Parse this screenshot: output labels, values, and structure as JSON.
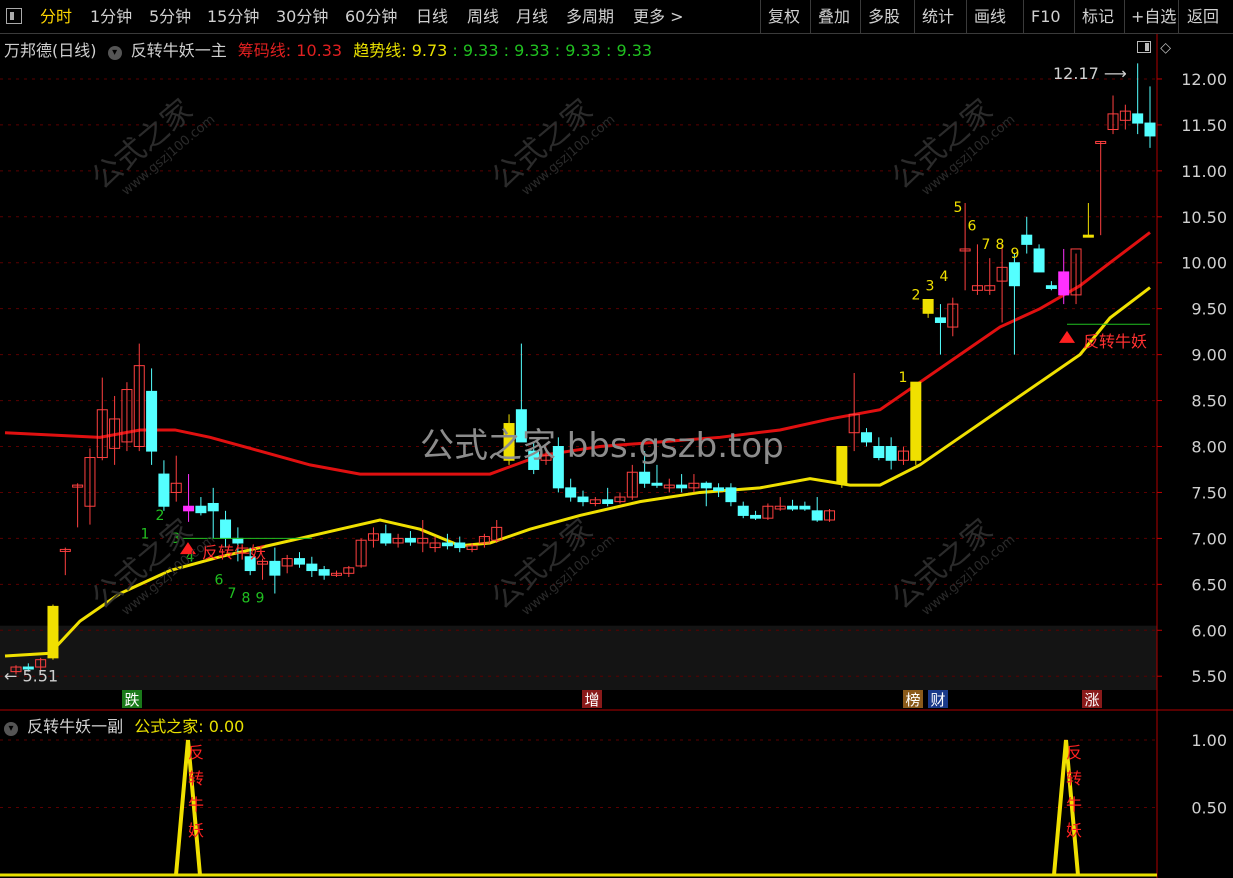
{
  "toolbar": {
    "left_items": [
      "分时",
      "1分钟",
      "5分钟",
      "15分钟",
      "30分钟",
      "60分钟",
      "日线",
      "周线",
      "月线",
      "多周期",
      "更多 >"
    ],
    "right_items": [
      "复权",
      "叠加",
      "多股",
      "统计",
      "画线",
      "F10",
      "标记",
      "+自选",
      "返回"
    ],
    "active": "分时"
  },
  "main_panel": {
    "stock_label": "万邦德(日线)",
    "indicator_name": "反转牛妖一主",
    "chip_label": "筹码线:",
    "chip_value": "10.33",
    "trend_label": "趋势线:",
    "trend_value": "9.73",
    "trend_extra": ": 9.33 : 9.33 : 9.33 : 9.33",
    "high_marker": "12.17",
    "low_marker": "5.51",
    "signal_text": "反转牛妖",
    "bottom_tags": [
      {
        "text": "跌",
        "color": "#1a7a1a"
      },
      {
        "text": "增",
        "color": "#8a1a1a"
      },
      {
        "text": "榜",
        "color": "#8a5a1a"
      },
      {
        "text": "财",
        "color": "#1a3a8a"
      },
      {
        "text": "涨",
        "color": "#8a1a1a"
      }
    ]
  },
  "sub_panel": {
    "indicator_name": "反转牛妖一副",
    "value_label": "公式之家:",
    "value": "0.00",
    "signal_text": "反转牛妖",
    "y_ticks": [
      "1.00",
      "0.50"
    ]
  },
  "watermark": {
    "center": "公式之家 bbs.gszb.top",
    "tile_text": "公式之家",
    "tile_url": "www.gszj100.com"
  },
  "chart_data": {
    "type": "candlestick",
    "ylim": [
      5.35,
      12.25
    ],
    "y_ticks": [
      12.0,
      11.5,
      11.0,
      10.5,
      10.0,
      9.5,
      9.0,
      8.5,
      8.0,
      7.5,
      7.0,
      6.5,
      6.0,
      5.5
    ],
    "candles": [
      [
        5.55,
        5.62,
        5.52,
        5.6
      ],
      [
        5.6,
        5.64,
        5.55,
        5.58
      ],
      [
        5.6,
        5.7,
        5.56,
        5.68
      ],
      [
        5.7,
        6.28,
        5.68,
        6.26
      ],
      [
        6.88,
        6.9,
        6.6,
        6.88
      ],
      [
        7.58,
        7.6,
        7.12,
        7.58
      ],
      [
        7.35,
        7.98,
        7.15,
        7.88
      ],
      [
        7.88,
        8.75,
        7.85,
        8.4
      ],
      [
        7.98,
        8.55,
        7.8,
        8.3
      ],
      [
        8.05,
        8.7,
        7.95,
        8.62
      ],
      [
        8.0,
        9.12,
        7.95,
        8.88
      ],
      [
        8.6,
        8.85,
        7.8,
        7.95
      ],
      [
        7.7,
        7.85,
        7.3,
        7.35
      ],
      [
        7.5,
        7.9,
        7.4,
        7.6
      ],
      [
        7.3,
        7.7,
        7.18,
        7.35
      ],
      [
        7.35,
        7.45,
        7.25,
        7.28
      ],
      [
        7.38,
        7.55,
        7.0,
        7.3
      ],
      [
        7.2,
        7.3,
        6.9,
        7.0
      ],
      [
        7.0,
        7.12,
        6.75,
        6.95
      ],
      [
        6.8,
        6.9,
        6.6,
        6.65
      ],
      [
        6.72,
        6.78,
        6.55,
        6.75
      ],
      [
        6.75,
        6.9,
        6.4,
        6.6
      ],
      [
        6.7,
        6.82,
        6.62,
        6.78
      ],
      [
        6.78,
        6.85,
        6.68,
        6.72
      ],
      [
        6.72,
        6.8,
        6.58,
        6.65
      ],
      [
        6.66,
        6.7,
        6.55,
        6.6
      ],
      [
        6.6,
        6.65,
        6.58,
        6.62
      ],
      [
        6.62,
        6.7,
        6.58,
        6.68
      ],
      [
        6.7,
        7.0,
        6.68,
        6.98
      ],
      [
        6.98,
        7.12,
        6.9,
        7.05
      ],
      [
        7.05,
        7.15,
        6.92,
        6.95
      ],
      [
        6.95,
        7.05,
        6.9,
        7.0
      ],
      [
        7.0,
        7.08,
        6.92,
        6.96
      ],
      [
        6.95,
        7.2,
        6.85,
        7.0
      ],
      [
        6.9,
        7.02,
        6.85,
        6.95
      ],
      [
        6.95,
        7.05,
        6.88,
        6.92
      ],
      [
        6.95,
        7.02,
        6.85,
        6.9
      ],
      [
        6.88,
        6.95,
        6.85,
        6.92
      ],
      [
        6.95,
        7.05,
        6.9,
        7.02
      ],
      [
        6.98,
        7.2,
        6.95,
        7.12
      ],
      [
        7.85,
        8.35,
        7.8,
        8.25
      ],
      [
        8.4,
        9.12,
        8.05,
        8.05
      ],
      [
        7.95,
        8.05,
        7.7,
        7.75
      ],
      [
        7.85,
        7.95,
        7.8,
        7.9
      ],
      [
        8.0,
        8.1,
        7.5,
        7.55
      ],
      [
        7.55,
        7.65,
        7.4,
        7.45
      ],
      [
        7.45,
        7.52,
        7.35,
        7.4
      ],
      [
        7.38,
        7.45,
        7.35,
        7.42
      ],
      [
        7.42,
        7.55,
        7.35,
        7.38
      ],
      [
        7.4,
        7.5,
        7.38,
        7.45
      ],
      [
        7.45,
        7.8,
        7.42,
        7.72
      ],
      [
        7.72,
        7.95,
        7.55,
        7.6
      ],
      [
        7.6,
        7.8,
        7.55,
        7.58
      ],
      [
        7.55,
        7.65,
        7.5,
        7.58
      ],
      [
        7.58,
        7.7,
        7.5,
        7.55
      ],
      [
        7.55,
        7.7,
        7.5,
        7.6
      ],
      [
        7.6,
        7.62,
        7.35,
        7.55
      ],
      [
        7.55,
        7.6,
        7.45,
        7.52
      ],
      [
        7.55,
        7.6,
        7.35,
        7.4
      ],
      [
        7.35,
        7.4,
        7.22,
        7.25
      ],
      [
        7.25,
        7.3,
        7.2,
        7.22
      ],
      [
        7.22,
        7.38,
        7.2,
        7.35
      ],
      [
        7.32,
        7.45,
        7.3,
        7.35
      ],
      [
        7.35,
        7.42,
        7.3,
        7.32
      ],
      [
        7.35,
        7.4,
        7.3,
        7.32
      ],
      [
        7.3,
        7.45,
        7.18,
        7.2
      ],
      [
        7.2,
        7.32,
        7.18,
        7.3
      ],
      [
        7.6,
        8.0,
        7.55,
        8.0
      ],
      [
        8.15,
        8.8,
        7.95,
        8.35
      ],
      [
        8.15,
        8.2,
        8.0,
        8.05
      ],
      [
        8.0,
        8.1,
        7.85,
        7.88
      ],
      [
        8.0,
        8.1,
        7.75,
        7.85
      ],
      [
        7.85,
        8.0,
        7.8,
        7.95
      ],
      [
        7.85,
        8.7,
        7.8,
        8.7
      ],
      [
        9.45,
        9.6,
        9.4,
        9.6
      ],
      [
        9.4,
        9.55,
        9.0,
        9.35
      ],
      [
        9.3,
        9.62,
        9.2,
        9.55
      ],
      [
        10.15,
        10.65,
        9.7,
        10.15
      ],
      [
        9.7,
        10.2,
        9.65,
        9.75
      ],
      [
        9.7,
        10.05,
        9.65,
        9.75
      ],
      [
        9.8,
        10.2,
        9.35,
        9.95
      ],
      [
        10.0,
        10.1,
        9.0,
        9.75
      ],
      [
        10.3,
        10.5,
        10.1,
        10.2
      ],
      [
        10.15,
        10.2,
        9.9,
        9.9
      ],
      [
        9.75,
        9.8,
        9.7,
        9.72
      ],
      [
        9.9,
        10.15,
        9.55,
        9.65
      ],
      [
        9.65,
        10.1,
        9.55,
        10.15
      ],
      [
        10.3,
        10.65,
        10.3,
        10.3
      ],
      [
        11.32,
        11.32,
        10.3,
        11.32
      ],
      [
        11.45,
        11.82,
        11.4,
        11.62
      ],
      [
        11.55,
        11.72,
        11.45,
        11.65
      ],
      [
        11.62,
        12.17,
        11.4,
        11.52
      ],
      [
        11.52,
        11.92,
        11.25,
        11.38
      ]
    ],
    "yellow_up_indices": [
      3,
      40,
      67,
      73,
      74,
      87
    ],
    "magenta_indices": [
      14,
      85
    ],
    "chip_line": [
      [
        5,
        8.15
      ],
      [
        100,
        8.1
      ],
      [
        140,
        8.18
      ],
      [
        175,
        8.18
      ],
      [
        210,
        8.1
      ],
      [
        260,
        7.95
      ],
      [
        310,
        7.8
      ],
      [
        360,
        7.7
      ],
      [
        420,
        7.7
      ],
      [
        490,
        7.7
      ],
      [
        540,
        7.9
      ],
      [
        600,
        8.0
      ],
      [
        660,
        8.05
      ],
      [
        720,
        8.1
      ],
      [
        780,
        8.18
      ],
      [
        830,
        8.3
      ],
      [
        880,
        8.4
      ],
      [
        920,
        8.7
      ],
      [
        960,
        9.0
      ],
      [
        1000,
        9.3
      ],
      [
        1040,
        9.5
      ],
      [
        1080,
        9.75
      ],
      [
        1110,
        10.0
      ],
      [
        1150,
        10.33
      ]
    ],
    "trend_line": [
      [
        5,
        5.72
      ],
      [
        50,
        5.75
      ],
      [
        80,
        6.1
      ],
      [
        120,
        6.4
      ],
      [
        170,
        6.65
      ],
      [
        220,
        6.8
      ],
      [
        280,
        6.95
      ],
      [
        340,
        7.1
      ],
      [
        380,
        7.2
      ],
      [
        420,
        7.1
      ],
      [
        460,
        6.92
      ],
      [
        490,
        6.95
      ],
      [
        530,
        7.1
      ],
      [
        580,
        7.25
      ],
      [
        640,
        7.4
      ],
      [
        700,
        7.5
      ],
      [
        760,
        7.55
      ],
      [
        810,
        7.65
      ],
      [
        850,
        7.58
      ],
      [
        880,
        7.58
      ],
      [
        920,
        7.8
      ],
      [
        960,
        8.1
      ],
      [
        1000,
        8.4
      ],
      [
        1040,
        8.7
      ],
      [
        1080,
        9.0
      ],
      [
        1110,
        9.4
      ],
      [
        1150,
        9.73
      ]
    ],
    "green_counts": [
      [
        "1",
        145,
        7.0
      ],
      [
        "2",
        160,
        7.2
      ],
      [
        "3",
        176,
        6.95
      ],
      [
        "4",
        190,
        6.75
      ],
      [
        "6",
        219,
        6.5
      ],
      [
        "7",
        232,
        6.35
      ],
      [
        "8",
        246,
        6.3
      ],
      [
        "9",
        260,
        6.3
      ]
    ],
    "yellow_counts": [
      [
        "1",
        903,
        8.7
      ],
      [
        "2",
        916,
        9.6
      ],
      [
        "3",
        930,
        9.7
      ],
      [
        "4",
        944,
        9.8
      ],
      [
        "5",
        958,
        10.55
      ],
      [
        "6",
        972,
        10.35
      ],
      [
        "7",
        986,
        10.15
      ],
      [
        "8",
        1000,
        10.15
      ],
      [
        "9",
        1015,
        10.05
      ]
    ]
  }
}
